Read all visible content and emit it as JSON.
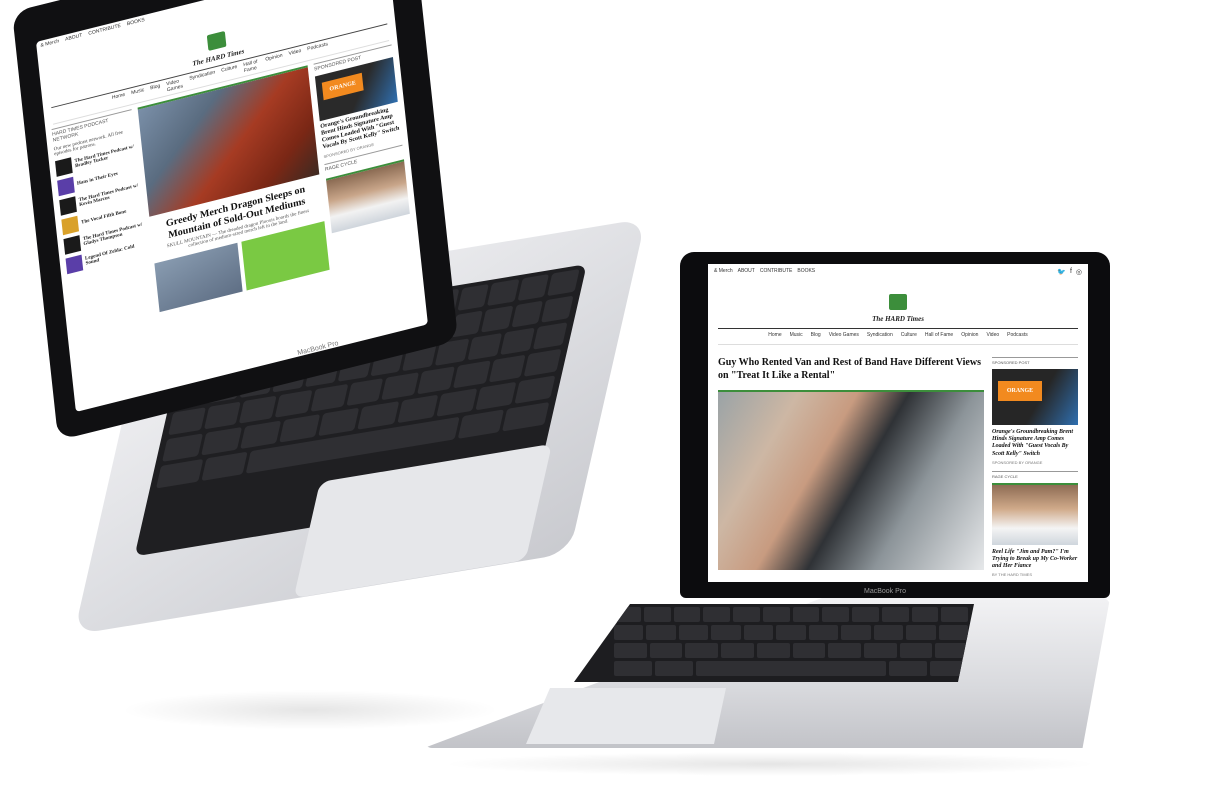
{
  "laptop_left": {
    "brand": "MacBook Pro",
    "site": {
      "top_links": [
        "& Merch",
        "ABOUT",
        "CONTRIBUTE",
        "BOOKS"
      ],
      "logo_text": "The HARD Times",
      "nav": [
        "Home",
        "Music",
        "Blog",
        "Video Games",
        "Syndication",
        "Culture",
        "Hall of Fame",
        "Opinion",
        "Video",
        "Podcasts"
      ],
      "left_heading": "HARD TIMES PODCAST NETWORK",
      "left_intro": "Our new podcast network. All free episodes for patrons.",
      "podcasts": [
        "The Hard Times Podcast w/ Bradley Tucker",
        "Hans in Their Eyes",
        "The Hard Times Podcast w/ Kevin Marcus",
        "The Vocal Fifth Bone",
        "The Hard Times Podcast w/ Gladys Thompson",
        "Legend Of Zelda: Cold Sound"
      ],
      "main_headline": "Greedy Merch Dragon Sleeps on Mountain of Sold-Out Mediums",
      "main_excerpt": "SKULL MOUNTAIN — The dreaded dragon Plooxis hoards the finest collection of medium-sized merch left in the land.",
      "right_heading": "SPONSORED POST",
      "amp_brand": "ORANGE",
      "right_title_1": "Orange's Groundbreaking Brent Hinds Signature Amp Comes Loaded With \"Guest Vocals By Scott Kelly\" Switch",
      "right_meta_1": "SPONSORED BY ORANGE",
      "right_heading_2": "RAGE CYCLE"
    }
  },
  "laptop_right": {
    "brand": "MacBook Pro",
    "site": {
      "top_links": [
        "& Merch",
        "ABOUT",
        "CONTRIBUTE",
        "BOOKS"
      ],
      "social": [
        "🐦",
        "f",
        "◎"
      ],
      "logo_text": "The HARD Times",
      "nav": [
        "Home",
        "Music",
        "Blog",
        "Video Games",
        "Syndication",
        "Culture",
        "Hall of Fame",
        "Opinion",
        "Video",
        "Podcasts"
      ],
      "main_headline": "Guy Who Rented Van and Rest of Band Have Different Views on \"Treat It Like a Rental\"",
      "right_heading": "SPONSORED POST",
      "amp_brand": "ORANGE",
      "right_title_1": "Orange's Groundbreaking Brent Hinds Signature Amp Comes Loaded With \"Guest Vocals By Scott Kelly\" Switch",
      "right_meta_1": "SPONSORED BY ORANGE",
      "right_heading_2": "RAGE CYCLE",
      "right_title_2": "Reel Life \"Jim and Pam?\" I'm Trying to Break up My Co-Worker and Her Fiance",
      "right_meta_2": "BY THE HARD TIMES"
    }
  }
}
